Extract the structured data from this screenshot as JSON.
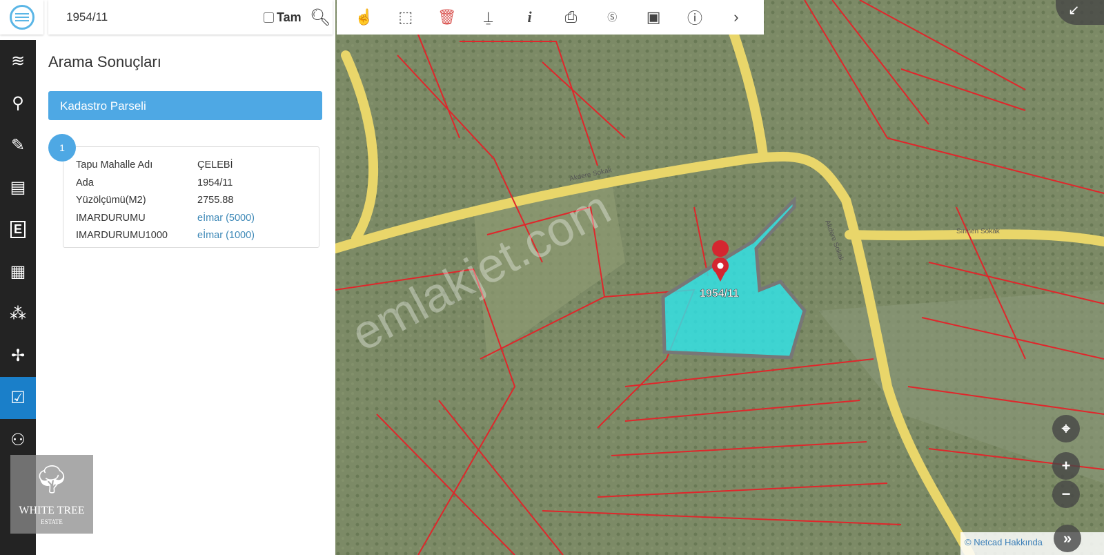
{
  "search": {
    "value": "1954/11",
    "exact_label": "Tam",
    "exact_checked": false
  },
  "toolbar": {
    "icons": [
      "hand-pointer-icon",
      "select-box-icon",
      "trash-icon",
      "street-view-icon",
      "info-icon",
      "print-icon",
      "scale-icon",
      "image-export-icon",
      "help-icon",
      "more-icon"
    ],
    "accent_delete": "#d9534f"
  },
  "sidebar": {
    "items": [
      "layers-icon",
      "search-icon",
      "pencil-icon",
      "book-icon",
      "e-icon",
      "grid-icon",
      "circles-icon",
      "signpost-icon",
      "clipboard-check-icon",
      "people-icon"
    ],
    "active_index": 8,
    "active_color": "#1a7fc9"
  },
  "panel": {
    "title": "Arama Sonuçları",
    "category": "Kadastro Parseli",
    "result_number": "1",
    "rows": [
      {
        "k": "Tapu Mahalle Adı",
        "v": "ÇELEBİ"
      },
      {
        "k": "Ada",
        "v": "1954/11"
      },
      {
        "k": "Yüzölçümü(M2)",
        "v": "2755.88"
      },
      {
        "k": "IMARDURUMU",
        "v": "eİmar (5000)"
      },
      {
        "k": "IMARDURUMU1000",
        "v": "eİmar (1000)"
      }
    ]
  },
  "map": {
    "marker_label": "1954/11",
    "watermark": "emlakjet.com",
    "road1": "Akdere Sokak",
    "road2": "Sırmen Sokak",
    "road3": "Akdere Sokak",
    "highlight_color": "#2ee6ec",
    "parcel_color": "#e0262b"
  },
  "logo": {
    "name": "WHITE TREE",
    "sub": "ESTATE"
  },
  "attribution": "© Netcad Hakkında"
}
